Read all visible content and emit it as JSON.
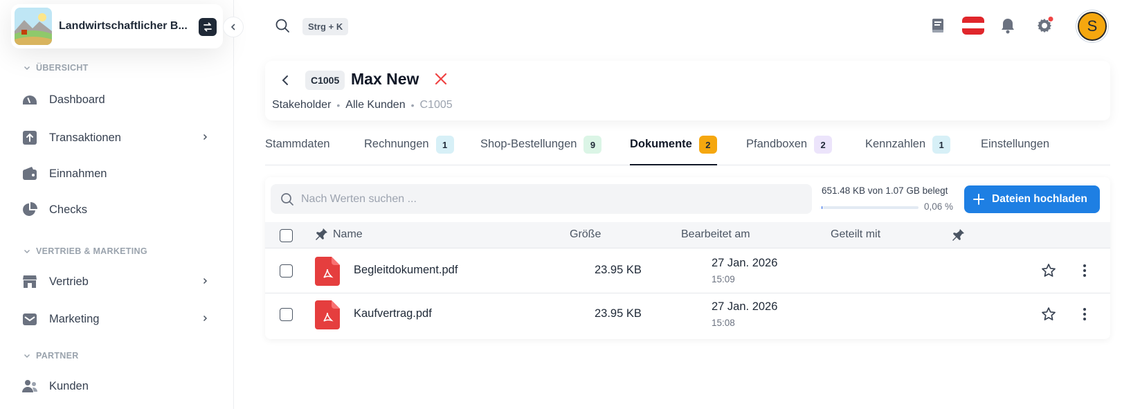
{
  "brand": {
    "name": "Landwirtschaftlicher B..."
  },
  "sidebar": {
    "sections": [
      {
        "title": "ÜBERSICHT"
      },
      {
        "title": "VERTRIEB & MARKETING"
      },
      {
        "title": "PARTNER"
      }
    ],
    "items": [
      {
        "label": "Dashboard",
        "icon": "gauge-icon"
      },
      {
        "label": "Transaktionen",
        "icon": "transfer-icon",
        "expandable": true
      },
      {
        "label": "Einnahmen",
        "icon": "wallet-icon"
      },
      {
        "label": "Checks",
        "icon": "pie-chart-icon"
      },
      {
        "label": "Vertrieb",
        "icon": "store-icon",
        "expandable": true
      },
      {
        "label": "Marketing",
        "icon": "mail-icon",
        "expandable": true
      },
      {
        "label": "Kunden",
        "icon": "users-icon"
      }
    ]
  },
  "topbar": {
    "shortcut": "Strg + K",
    "avatar_initial": "S",
    "colors": {
      "avatar": "#f5a70f",
      "notification_dot": "#ef4444",
      "flag_red": "#e0262b"
    }
  },
  "customer": {
    "id": "C1005",
    "name": "Max New",
    "breadcrumb": [
      "Stakeholder",
      "Alle Kunden",
      "C1005"
    ]
  },
  "tabs": [
    {
      "label": "Stammdaten",
      "count": null
    },
    {
      "label": "Rechnungen",
      "count": "1",
      "color": "#d7f0f7"
    },
    {
      "label": "Shop-Bestellungen",
      "count": "9",
      "color": "#dbf5e6"
    },
    {
      "label": "Dokumente",
      "count": "2",
      "color": "#f5a70f",
      "active": true
    },
    {
      "label": "Pfandboxen",
      "count": "2",
      "color": "#ece4fb"
    },
    {
      "label": "Kennzahlen",
      "count": "1",
      "color": "#d7f0f7"
    },
    {
      "label": "Einstellungen",
      "count": null
    }
  ],
  "documents": {
    "search_placeholder": "Nach Werten suchen ...",
    "storage_text": "651.48 KB von 1.07 GB belegt",
    "storage_percent_label": "0,06 %",
    "storage_fraction": 0.0006,
    "upload_label": "Dateien hochladen",
    "columns": {
      "name": "Name",
      "size": "Größe",
      "edited": "Bearbeitet am",
      "shared": "Geteilt mit"
    },
    "rows": [
      {
        "name": "Begleitdokument.pdf",
        "size": "23.95 KB",
        "date": "27 Jan. 2026",
        "time": "15:09",
        "shared": ""
      },
      {
        "name": "Kaufvertrag.pdf",
        "size": "23.95 KB",
        "date": "27 Jan. 2026",
        "time": "15:08",
        "shared": ""
      }
    ]
  }
}
